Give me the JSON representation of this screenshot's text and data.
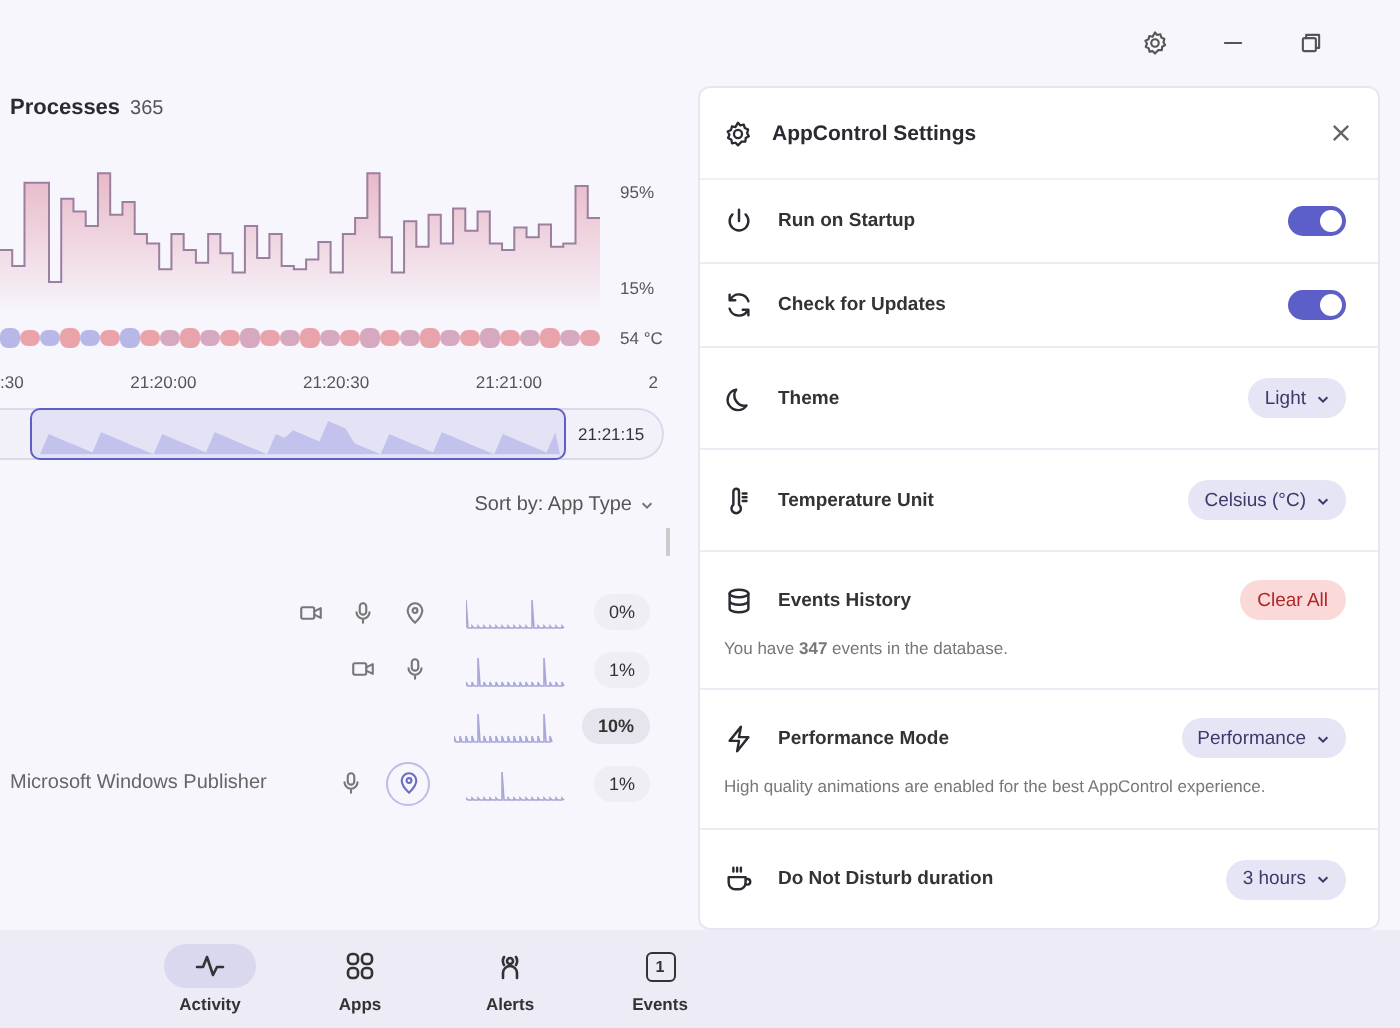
{
  "processes": {
    "title": "Processes",
    "count": "365"
  },
  "chart": {
    "top_label": "95%",
    "bottom_label": "15%",
    "temperature": "54 °C",
    "times": [
      ":30",
      "21:20:00",
      "21:20:30",
      "21:21:00",
      "2"
    ]
  },
  "timeline": {
    "end_time": "21:21:15"
  },
  "sort": {
    "label": "Sort by: App Type"
  },
  "apps": [
    {
      "icons": [
        {
          "kind": "camera",
          "active": false
        },
        {
          "kind": "mic",
          "active": false
        },
        {
          "kind": "location",
          "active": false
        }
      ],
      "usage": "0%",
      "high": false
    },
    {
      "icons": [
        {
          "kind": "camera",
          "active": false
        },
        {
          "kind": "mic",
          "active": false
        }
      ],
      "usage": "1%",
      "high": false
    },
    {
      "usage": "10%",
      "high": true
    },
    {
      "name": "Microsoft Windows Publisher",
      "icons": [
        {
          "kind": "mic",
          "active": false
        },
        {
          "kind": "location",
          "active": true
        }
      ],
      "usage": "1%",
      "high": false
    }
  ],
  "settings": {
    "title": "AppControl Settings",
    "items": [
      {
        "label": "Run on Startup",
        "kind": "toggle",
        "on": true
      },
      {
        "label": "Check for Updates",
        "kind": "toggle",
        "on": true
      },
      {
        "label": "Theme",
        "kind": "dropdown",
        "value": "Light"
      },
      {
        "label": "Temperature Unit",
        "kind": "dropdown",
        "value": "Celsius (°C)"
      },
      {
        "label": "Events History",
        "kind": "button",
        "value": "Clear All",
        "description": "You have **347** events in the database."
      },
      {
        "label": "Performance Mode",
        "kind": "dropdown",
        "value": "Performance",
        "description": "High quality animations are enabled for the best AppControl experience."
      },
      {
        "label": "Do Not Disturb duration",
        "kind": "dropdown",
        "value": "3 hours"
      }
    ]
  },
  "nav": [
    {
      "label": "Activity",
      "selected": true
    },
    {
      "label": "Apps",
      "selected": false
    },
    {
      "label": "Alerts",
      "selected": false
    },
    {
      "label": "Events",
      "badge": "1",
      "selected": false
    }
  ]
}
